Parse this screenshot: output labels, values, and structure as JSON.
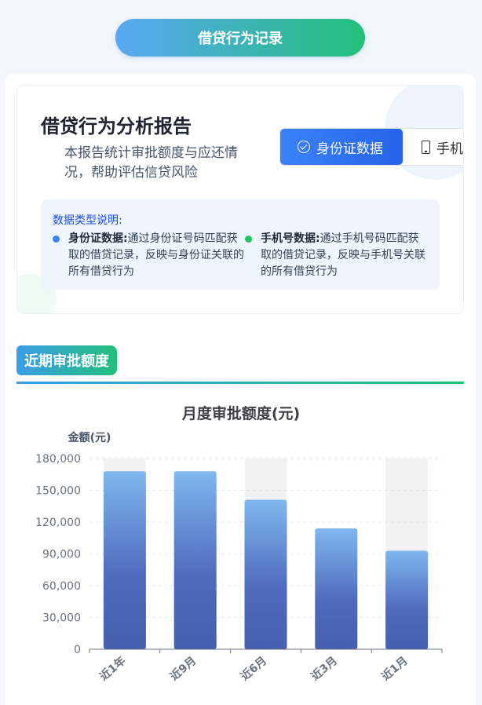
{
  "header": {
    "title": "借贷行为记录"
  },
  "report": {
    "title": "借贷行为分析报告",
    "description": "本报告统计审批额度与应还情况，帮助评估信贷风险",
    "tabs": [
      {
        "label": "身份证数据",
        "icon": "check-circle-icon",
        "active": true
      },
      {
        "label": "手机",
        "icon": "phone-icon",
        "active": false
      }
    ],
    "info": {
      "title": "数据类型说明:",
      "items": [
        {
          "term": "身份证数据:",
          "text": "通过身份证号码匹配获取的借贷记录，反映与身份证关联的所有借贷行为",
          "color": "#3b82f6"
        },
        {
          "term": "手机号数据:",
          "text": "通过手机号码匹配获取的借贷记录，反映与手机号关联的所有借贷行为",
          "color": "#22c55e"
        }
      ]
    }
  },
  "section": {
    "title": "近期审批额度"
  },
  "chart_data": {
    "type": "bar",
    "title": "月度审批额度(元)",
    "ylabel": "金额(元)",
    "categories": [
      "近1年",
      "近9月",
      "近6月",
      "近3月",
      "近1月"
    ],
    "values": [
      168000,
      168000,
      141000,
      114000,
      93000
    ],
    "ylim": [
      0,
      180000
    ],
    "yticks": [
      0,
      30000,
      60000,
      90000,
      120000,
      150000,
      180000
    ],
    "ytick_labels": [
      "0",
      "30,000",
      "60,000",
      "90,000",
      "120,000",
      "150,000",
      "180,000"
    ],
    "colors": {
      "bar_top": "#7fb8ee",
      "bar_bottom": "#4a63b4",
      "band": "#f2f2f2",
      "grid": "#e5e7eb"
    },
    "grid": true
  }
}
